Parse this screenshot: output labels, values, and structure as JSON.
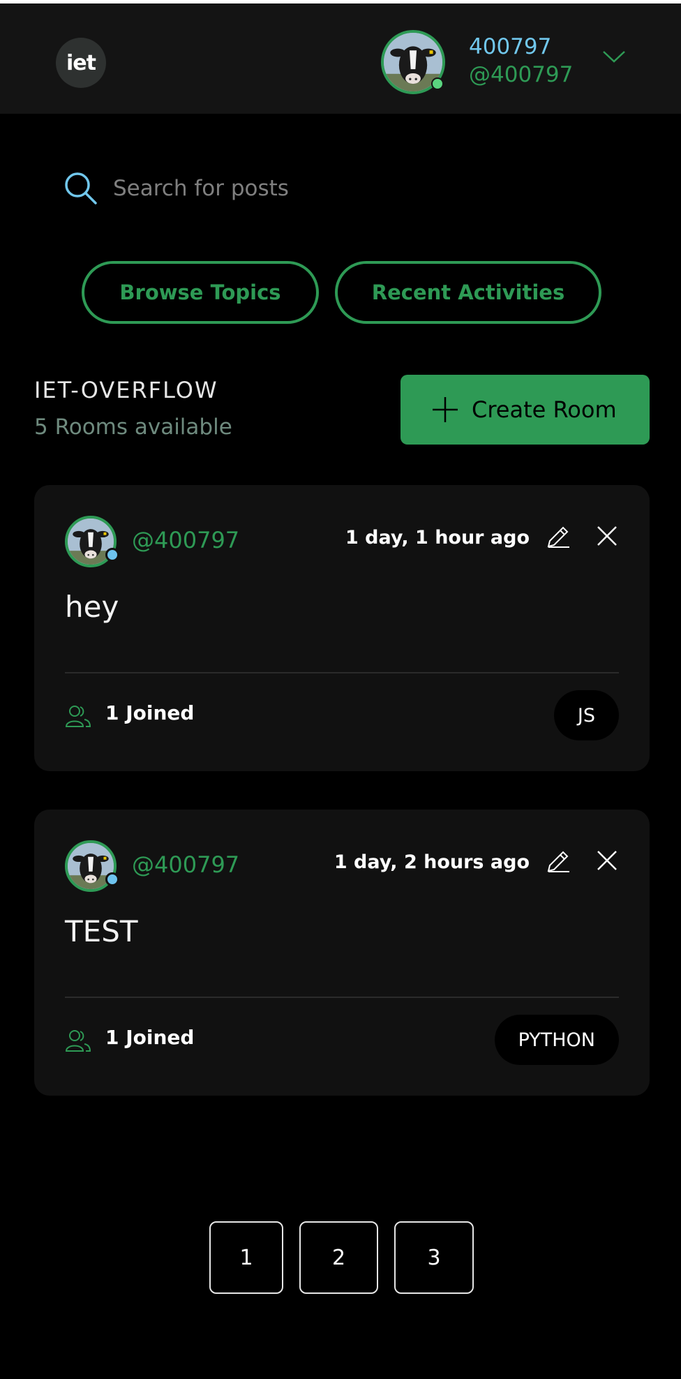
{
  "header": {
    "logo_text": "iet",
    "user": {
      "name": "400797",
      "handle": "@400797"
    }
  },
  "search": {
    "placeholder": "Search for posts"
  },
  "nav": {
    "browse_label": "Browse Topics",
    "recent_label": "Recent Activities"
  },
  "section": {
    "title": "IET-OVERFLOW",
    "count_text": "5 Rooms available",
    "create_label": "Create Room"
  },
  "rooms": [
    {
      "handle": "@400797",
      "time": "1 day, 1 hour ago",
      "title": "hey",
      "joined": "1 Joined",
      "topic": "JS"
    },
    {
      "handle": "@400797",
      "time": "1 day, 2 hours ago",
      "title": "TEST",
      "joined": "1 Joined",
      "topic": "PYTHON"
    }
  ],
  "pagination": [
    "1",
    "2",
    "3"
  ],
  "colors": {
    "accent": "#2e9a55",
    "username": "#71c7ec",
    "card_bg": "#111111",
    "header_bg": "#141414",
    "online_dot": "#5ad57f",
    "card_dot": "#6ec3ee"
  }
}
